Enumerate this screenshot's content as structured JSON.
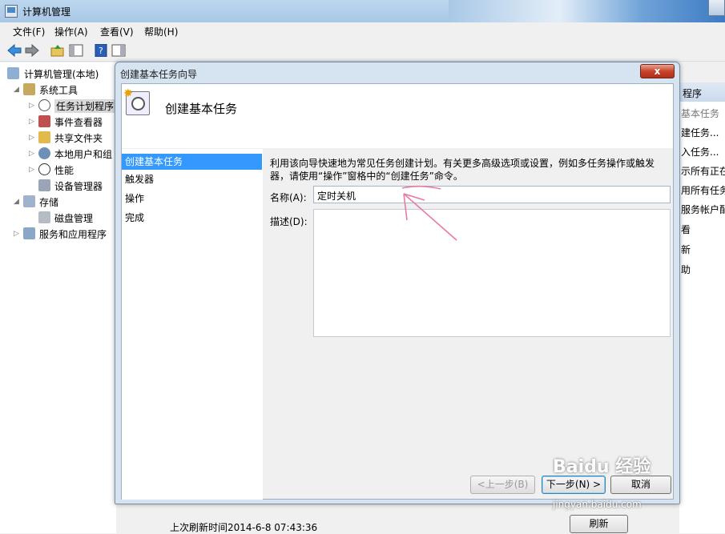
{
  "window": {
    "title": "计算机管理"
  },
  "menu": [
    "文件(F)",
    "操作(A)",
    "查看(V)",
    "帮助(H)"
  ],
  "tree": {
    "root": "计算机管理(本地)",
    "system_tools": "系统工具",
    "task_scheduler": "任务计划程序",
    "event_viewer": "事件查看器",
    "shared_folders": "共享文件夹",
    "local_users": "本地用户和组",
    "performance": "性能",
    "device_manager": "设备管理器",
    "storage": "存储",
    "disk_mgmt": "磁盘管理",
    "services_apps": "服务和应用程序"
  },
  "actions": {
    "header": "程序",
    "items": [
      "基本任务",
      "建任务...",
      "入任务...",
      "示所有正在",
      "用所有任务",
      "服务帐户配",
      "看",
      "新",
      "助"
    ]
  },
  "dialog": {
    "title": "创建基本任务向导",
    "close": "x",
    "heading": "创建基本任务",
    "steps": [
      "创建基本任务",
      "触发器",
      "操作",
      "完成"
    ],
    "description": "利用该向导快速地为常见任务创建计划。有关更多高级选项或设置，例如多任务操作或触发器，请使用“操作”窗格中的“创建任务”命令。",
    "name_label": "名称(A):",
    "name_value": "定时关机",
    "desc_label": "描述(D):",
    "back": "<上一步(B)",
    "next": "下一步(N) >",
    "cancel": "取消"
  },
  "status": {
    "last_refresh": "上次刷新时间2014-6-8 07:43:36",
    "refresh": "刷新"
  },
  "watermark": {
    "logo": "Baidu 经验",
    "url": "jingyan.baidu.com"
  }
}
